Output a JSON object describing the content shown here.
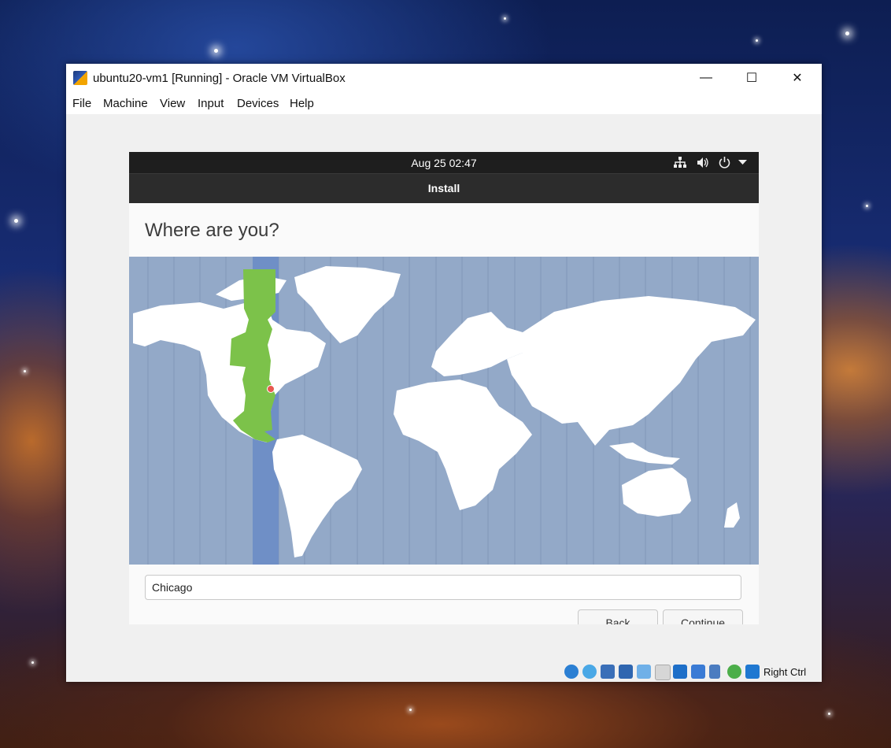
{
  "window": {
    "title": "ubuntu20-vm1 [Running] - Oracle VM VirtualBox",
    "minimize_glyph": "—",
    "maximize_glyph": "☐",
    "close_glyph": "✕"
  },
  "menu": [
    "File",
    "Machine",
    "View",
    "Input",
    "Devices",
    "Help"
  ],
  "guest": {
    "clock": "Aug 25  02:47",
    "tray_icons": [
      "network-icon",
      "volume-icon",
      "power-icon",
      "chevron-down-icon"
    ],
    "header_title": "Install",
    "heading": "Where are you?",
    "city_value": "Chicago",
    "back_label": "Back",
    "continue_label": "Continue",
    "map_colors": {
      "ocean": "#93a9c8",
      "land": "#ffffff",
      "selected_zone": "#7cc24a",
      "zone_band": "#6f8fc6"
    }
  },
  "statusbar": {
    "icons": [
      "hard-disk-icon",
      "optical-disk-icon",
      "audio-icon",
      "network-adapters-icon",
      "usb-icon",
      "shared-folders-icon",
      "display-icon",
      "recording-icon",
      "virtualization-icon",
      "mouse-integration-icon",
      "keyboard-capture-icon"
    ],
    "host_key": "Right Ctrl"
  }
}
